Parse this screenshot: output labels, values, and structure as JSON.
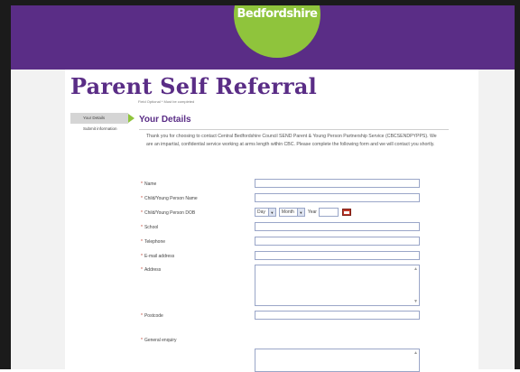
{
  "brand": {
    "logo_text": "Bedfordshire"
  },
  "page": {
    "title": "Parent Self Referral"
  },
  "legend": {
    "star": "*",
    "text": "Field Optional  *  Must be completed"
  },
  "sidenav": {
    "items": [
      {
        "label": "Your Details"
      },
      {
        "label": "Submit information"
      }
    ]
  },
  "section": {
    "title": "Your Details"
  },
  "intro": "Thank you for choosing to contact Central Bedfordshire Council SEND Parent & Young Person Partnership Service (CBCSENDPYPPS). We are an impartial, confidential service working at arms length within CBC. Please complete the following form and we will contact you shortly.",
  "form": {
    "required_mark": "*",
    "fields": {
      "name": "Name",
      "child_name": "Child/Young Person Name",
      "child_dob": "Child/Young Person DOB",
      "school": "School",
      "telephone": "Telephone",
      "email": "E-mail address",
      "address": "Address",
      "postcode": "Postcode",
      "general_enquiry": "General enquiry"
    },
    "dob": {
      "day": "Day",
      "month": "Month",
      "year_label": "Year"
    }
  },
  "icons": {
    "dropdown": "chevron-down-icon",
    "calendar": "calendar-icon"
  },
  "colors": {
    "brand_purple": "#5a2d86",
    "brand_green": "#8fc43c",
    "required_red": "#c0392b"
  }
}
